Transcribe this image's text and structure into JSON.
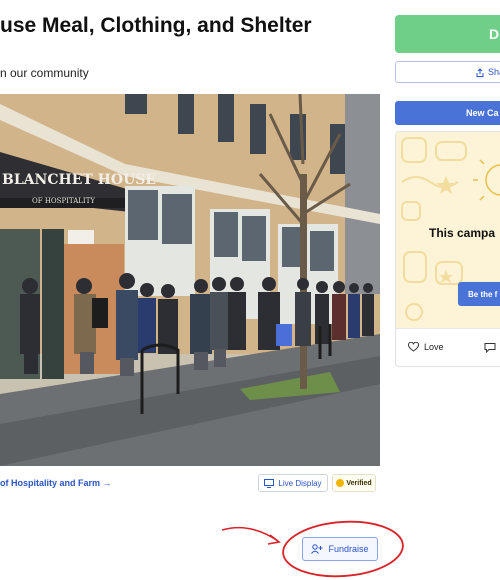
{
  "campaign": {
    "title": "use Meal, Clothing, and Shelter",
    "subtitle": "n our community",
    "photo_sign_line1": "BLANCHET HOUSE",
    "photo_sign_line2": "OF HOSPITALITY",
    "org_link": "of Hospitality and Farm →",
    "live_display_label": "Live Display",
    "verified_label": "Verified",
    "fundraise_label": "Fundraise"
  },
  "sidebar": {
    "donate_label": "D",
    "share_label": "Sha",
    "new_campaign_label": "New Ca",
    "card_text": "This campa",
    "card_button_label": "Be the f",
    "love_label": "Love"
  },
  "colors": {
    "accent_blue": "#2b54c5",
    "donate_green": "#6fcf88",
    "annotation_red": "#d8232a",
    "card_bg": "#fdf3d6"
  },
  "icons": {
    "live_display": "monitor-icon",
    "verified": "verified-badge-icon",
    "fundraise": "add-user-icon",
    "share": "share-icon",
    "love": "heart-icon",
    "comment": "comment-icon"
  }
}
